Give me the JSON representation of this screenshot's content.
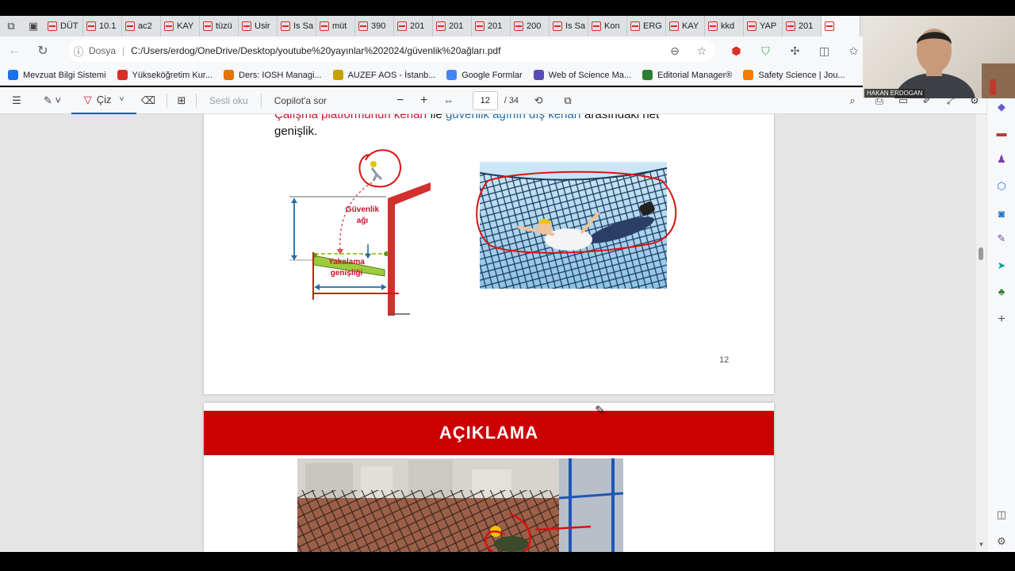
{
  "tabs": {
    "items": [
      {
        "label": "DÜT"
      },
      {
        "label": "10.1"
      },
      {
        "label": "ac2"
      },
      {
        "label": "KAY"
      },
      {
        "label": "tüzü"
      },
      {
        "label": "Usir"
      },
      {
        "label": "Is Sa"
      },
      {
        "label": "müt"
      },
      {
        "label": "390"
      },
      {
        "label": "201"
      },
      {
        "label": "201"
      },
      {
        "label": "201"
      },
      {
        "label": "200"
      },
      {
        "label": "Is Sa"
      },
      {
        "label": "Kon"
      },
      {
        "label": "ERG"
      },
      {
        "label": "KAY"
      },
      {
        "label": "kkd"
      },
      {
        "label": "YAP"
      },
      {
        "label": "201"
      },
      {
        "label": ""
      }
    ]
  },
  "address": {
    "scheme_label": "Dosya",
    "url": "C:/Users/erdog/OneDrive/Desktop/youtube%20yayınlar%202024/güvenlik%20ağları.pdf"
  },
  "favorites": [
    {
      "label": "Mevzuat Bilgi Sistemi",
      "color": "#1a73e8"
    },
    {
      "label": "Yükseköğretim Kur...",
      "color": "#d93025"
    },
    {
      "label": "Ders: IOSH Managi...",
      "color": "#e37400"
    },
    {
      "label": "AUZEF AOS - İstanb...",
      "color": "#c5a100"
    },
    {
      "label": "Google Formlar",
      "color": "#4285f4"
    },
    {
      "label": "Web of Science Ma...",
      "color": "#5b4bb7"
    },
    {
      "label": "Editorial Manager®",
      "color": "#2e7d32"
    },
    {
      "label": "Safety Science | Jou...",
      "color": "#f57c00"
    }
  ],
  "pdf_toolbar": {
    "draw_label": "Çiz",
    "read_aloud_label": "Sesli oku",
    "copilot_label": "Copilot'a sor",
    "current_page": "12",
    "total_pages": "/ 34"
  },
  "page12": {
    "caption_red": "Çalışma platformunun kenarı",
    "caption_mid": " ile ",
    "caption_blue": "güvenlik ağının dış kenarı",
    "caption_end": " arasındaki net genişlik.",
    "diagram_label_net": "Güvenlik ağı",
    "diagram_label_width": "Yakalama genişliği",
    "page_number": "12"
  },
  "page13": {
    "banner": "AÇIKLAMA"
  },
  "webcam": {
    "name": "HAKAN ERDOGAN"
  }
}
